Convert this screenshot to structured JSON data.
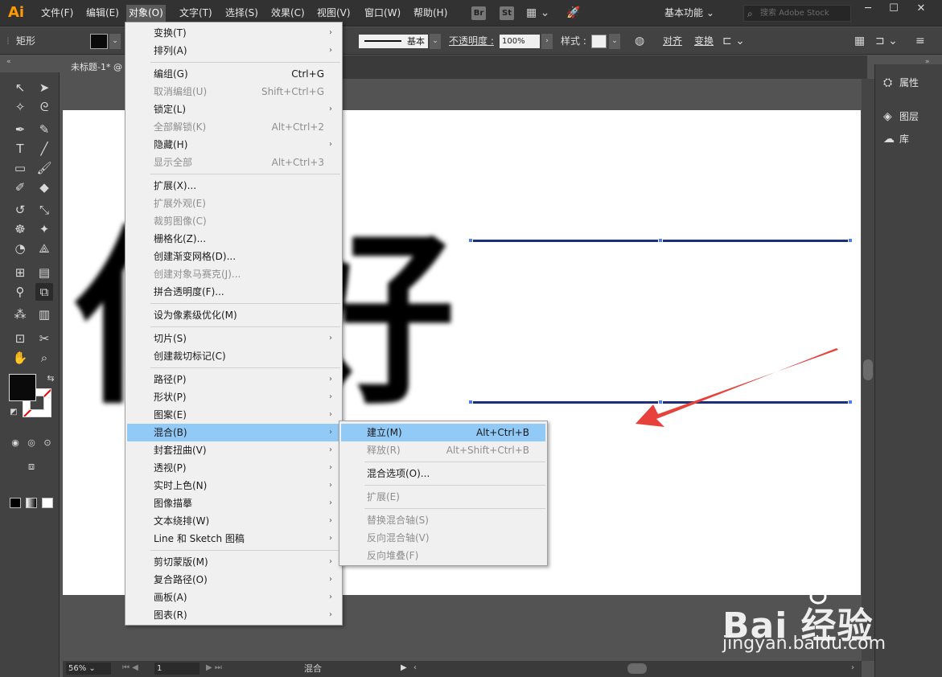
{
  "app": {
    "logo": "Ai",
    "workspace": "基本功能",
    "search_placeholder": "搜索 Adobe Stock",
    "bridge_icon": "Br",
    "stock_icon": "St"
  },
  "menubar": {
    "file": "文件(F)",
    "edit": "编辑(E)",
    "object": "对象(O)",
    "type": "文字(T)",
    "select": "选择(S)",
    "effect": "效果(C)",
    "view": "视图(V)",
    "window": "窗口(W)",
    "help": "帮助(H)"
  },
  "controlbar": {
    "selection_type": "矩形",
    "stroke_profile": "基本",
    "opacity_label": "不透明度 :",
    "opacity_value": "100%",
    "style_label": "样式 :",
    "align_label": "对齐",
    "transform_label": "变换"
  },
  "document": {
    "tab_title": "未标题-1* @"
  },
  "object_menu": {
    "transform": "变换(T)",
    "arrange": "排列(A)",
    "group": "编组(G)",
    "group_sc": "Ctrl+G",
    "ungroup": "取消编组(U)",
    "ungroup_sc": "Shift+Ctrl+G",
    "lock": "锁定(L)",
    "unlock_all": "全部解锁(K)",
    "unlock_all_sc": "Alt+Ctrl+2",
    "hide": "隐藏(H)",
    "show_all": "显示全部",
    "show_all_sc": "Alt+Ctrl+3",
    "expand": "扩展(X)...",
    "expand_appearance": "扩展外观(E)",
    "crop_image": "裁剪图像(C)",
    "rasterize": "栅格化(Z)...",
    "gradient_mesh": "创建渐变网格(D)...",
    "object_mosaic": "创建对象马赛克(J)...",
    "flatten_transparency": "拼合透明度(F)...",
    "pixel_perfect": "设为像素级优化(M)",
    "slice": "切片(S)",
    "crop_marks": "创建裁切标记(C)",
    "path": "路径(P)",
    "shape": "形状(P)",
    "pattern": "图案(E)",
    "blend": "混合(B)",
    "envelope_distort": "封套扭曲(V)",
    "perspective": "透视(P)",
    "live_paint": "实时上色(N)",
    "image_trace": "图像描摹",
    "text_wrap": "文本绕排(W)",
    "line_sketch": "Line 和 Sketch 图稿",
    "clipping_mask": "剪切蒙版(M)",
    "compound_path": "复合路径(O)",
    "artboards": "画板(A)",
    "graph": "图表(R)"
  },
  "blend_submenu": {
    "make": "建立(M)",
    "make_sc": "Alt+Ctrl+B",
    "release": "释放(R)",
    "release_sc": "Alt+Shift+Ctrl+B",
    "options": "混合选项(O)...",
    "expand": "扩展(E)",
    "replace_spine": "替换混合轴(S)",
    "reverse_spine": "反向混合轴(V)",
    "reverse_front_back": "反向堆叠(F)"
  },
  "panels": {
    "properties": "属性",
    "layers": "图层",
    "libraries": "库"
  },
  "statusbar": {
    "zoom": "56%",
    "page": "1",
    "current_tool": "混合"
  },
  "artwork": {
    "text": "你好"
  },
  "watermark": {
    "logo": "Bai  经验",
    "url": "jingyan.baidu.com"
  },
  "colors": {
    "menu_highlight": "#91c9f7",
    "blend_line": "#1d2f7a",
    "annotation_arrow": "#e8413c",
    "app_logo": "#ff9a00"
  }
}
